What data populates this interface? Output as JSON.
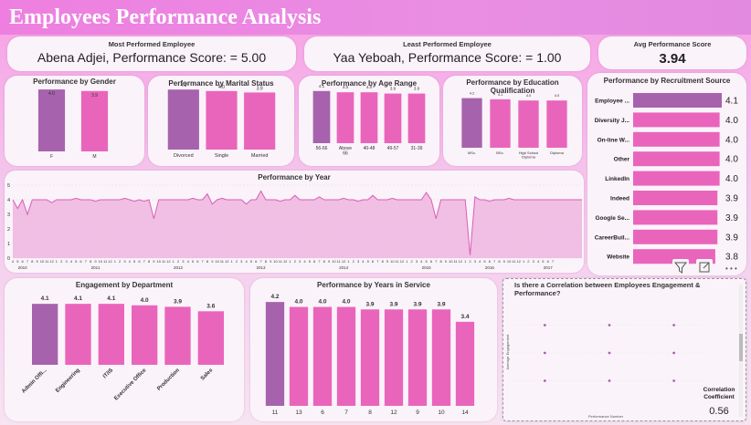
{
  "header": {
    "title": "Employees Performance Analysis"
  },
  "kpis": {
    "most": {
      "label": "Most Performed Employee",
      "value": "Abena Adjei, Performance Score: = 5.00"
    },
    "least": {
      "label": "Least Performed Employee",
      "value": "Yaa Yeboah, Performance Score: = 1.00"
    },
    "avg": {
      "label": "Avg Performance Score",
      "value": "3.94"
    }
  },
  "colors": {
    "purple": "#a762ad",
    "pink": "#e965bb",
    "header": "#ee7fe0",
    "area": "#efb4df",
    "line": "#d95fb6"
  },
  "toolbar": {
    "icons": [
      "filter-icon",
      "focus-mode-icon",
      "more-options-icon"
    ],
    "more": "• • •"
  },
  "chart_data": [
    {
      "id": "gender",
      "type": "bar",
      "title": "Performance by Gender",
      "categories": [
        "F",
        "M"
      ],
      "values": [
        4.0,
        3.9
      ],
      "data_labels": [
        "4.0",
        "3.9"
      ],
      "ylim": [
        0,
        4.3
      ]
    },
    {
      "id": "marital",
      "type": "bar",
      "title": "Performance by Marital Status",
      "categories": [
        "Divorced",
        "Single",
        "Married"
      ],
      "values": [
        4.1,
        4.0,
        3.9
      ],
      "data_labels": [
        "4.1",
        "4.0",
        "3.9"
      ],
      "ylim": [
        0,
        4.3
      ]
    },
    {
      "id": "age",
      "type": "bar",
      "title": "Performance by Age Range",
      "categories": [
        "56-66",
        "Above 66",
        "40-48",
        "49-57",
        "31-39"
      ],
      "values": [
        4.1,
        4.0,
        4.0,
        3.9,
        3.9
      ],
      "data_labels": [
        "4.1",
        "4.0",
        "4.0",
        "3.9",
        "3.9"
      ],
      "ylim": [
        0,
        4.3
      ]
    },
    {
      "id": "education",
      "type": "bar",
      "title": "Performance by Education Qualification",
      "categories": [
        "MSc.",
        "BSc.",
        "High School Diploma",
        "Diploma"
      ],
      "values": [
        4.2,
        4.1,
        4.0,
        4.0
      ],
      "data_labels": [
        "4.2",
        "4.1",
        "4.0",
        "4.0"
      ],
      "ylim": [
        0,
        4.4
      ]
    },
    {
      "id": "recruitment",
      "type": "bar",
      "orientation": "horizontal",
      "title": "Performance by Recruitment Source",
      "categories": [
        "Employee ...",
        "Diversity J...",
        "On-line W...",
        "Other",
        "LinkedIn",
        "Indeed",
        "Google Se...",
        "CareerBuil...",
        "Website"
      ],
      "values": [
        4.1,
        4.0,
        4.0,
        4.0,
        4.0,
        3.9,
        3.9,
        3.9,
        3.8
      ],
      "data_labels": [
        "4.1",
        "4.0",
        "4.0",
        "4.0",
        "4.0",
        "3.9",
        "3.9",
        "3.9",
        "3.8"
      ],
      "xlim": [
        0,
        4.1
      ]
    },
    {
      "id": "year",
      "type": "area",
      "title": "Performance by Year",
      "ylim": [
        0,
        5
      ],
      "yticks": [
        "0",
        "1",
        "2",
        "3",
        "4",
        "5"
      ],
      "years": [
        "2010",
        "2011",
        "2012",
        "2013",
        "2014",
        "2015",
        "2016",
        "2017"
      ],
      "year_month_index": [
        2,
        17,
        34,
        51,
        68,
        85,
        98,
        110
      ],
      "months": [
        4,
        5,
        6,
        7,
        8,
        9,
        10,
        11,
        12,
        1,
        2,
        3,
        4,
        5,
        6,
        7,
        8,
        9,
        10,
        11,
        12,
        1,
        2,
        3,
        4,
        5,
        6,
        7,
        8,
        9,
        10,
        11,
        12,
        1,
        2,
        3,
        4,
        5,
        6,
        7,
        8,
        9,
        10,
        11,
        12,
        1,
        2,
        3,
        4,
        5,
        6,
        7,
        8,
        9,
        10,
        11,
        12,
        1,
        2,
        3,
        4,
        5,
        6,
        7,
        8,
        9,
        10,
        11,
        12,
        1,
        2,
        3,
        4,
        5,
        6,
        7,
        8,
        9,
        10,
        11,
        12,
        1,
        2,
        3,
        4,
        5,
        6,
        7,
        8,
        9,
        10,
        11,
        12,
        1,
        2,
        3,
        4,
        5,
        6,
        7,
        8,
        9,
        10,
        11,
        12,
        1,
        2,
        3,
        4,
        5,
        6,
        7
      ],
      "values": [
        4.0,
        3.4,
        4.0,
        3.0,
        4.0,
        4.0,
        4.0,
        4.0,
        3.8,
        4.0,
        4.0,
        4.0,
        4.0,
        4.1,
        4.0,
        4.0,
        4.0,
        3.9,
        4.0,
        4.0,
        4.0,
        4.0,
        4.0,
        4.1,
        4.0,
        3.9,
        4.0,
        3.9,
        4.0,
        2.7,
        4.0,
        4.0,
        4.0,
        4.0,
        4.0,
        4.0,
        4.0,
        4.1,
        4.0,
        4.0,
        4.4,
        3.7,
        4.0,
        4.1,
        4.0,
        4.0,
        4.0,
        4.0,
        3.7,
        4.0,
        4.0,
        4.6,
        4.0,
        4.0,
        4.0,
        3.9,
        4.0,
        4.0,
        4.3,
        4.0,
        4.0,
        4.0,
        4.0,
        4.2,
        4.0,
        4.0,
        4.0,
        4.0,
        4.1,
        4.0,
        4.0,
        3.9,
        4.0,
        4.0,
        4.3,
        4.0,
        4.0,
        4.0,
        4.1,
        4.0,
        4.0,
        4.0,
        4.0,
        4.0,
        4.0,
        4.5,
        4.0,
        2.7,
        4.0,
        4.0,
        4.0,
        4.0,
        4.0,
        4.0,
        0.2,
        4.2,
        4.0,
        4.0,
        3.9,
        4.0,
        4.0,
        4.0,
        4.1,
        4.0,
        4.0,
        4.0,
        4.0,
        4.0,
        4.0,
        4.0,
        4.0,
        4.0,
        4.0,
        4.0,
        4.0,
        4.0,
        4.0,
        4.0
      ]
    },
    {
      "id": "department",
      "type": "bar",
      "title": "Engagement by Department",
      "categories": [
        "Admin Offi...",
        "Engineering",
        "IT/IS",
        "Executive Office",
        "Production",
        "Sales"
      ],
      "values": [
        4.1,
        4.1,
        4.1,
        4.0,
        3.9,
        3.6
      ],
      "data_labels": [
        "4.1",
        "4.1",
        "4.1",
        "4.0",
        "3.9",
        "3.6"
      ],
      "ylim": [
        0,
        4.6
      ]
    },
    {
      "id": "service",
      "type": "bar",
      "title": "Performance by Years in Service",
      "categories": [
        "11",
        "13",
        "6",
        "7",
        "8",
        "12",
        "9",
        "10",
        "14"
      ],
      "values": [
        4.2,
        4.0,
        4.0,
        4.0,
        3.9,
        3.9,
        3.9,
        3.9,
        3.4
      ],
      "data_labels": [
        "4.2",
        "4.0",
        "4.0",
        "4.0",
        "3.9",
        "3.9",
        "3.9",
        "3.9",
        "3.4"
      ],
      "ylim": [
        0,
        4.5
      ]
    },
    {
      "id": "correlation",
      "type": "scatter",
      "title": "Is there a Correlation between Employees Engagement & Performance?",
      "xlabel": "Performance Number",
      "ylabel": "Average Engagement",
      "x": [
        2,
        2,
        2,
        3,
        3,
        3,
        4,
        4,
        4
      ],
      "y": [
        4.5,
        4.0,
        3.5,
        4.5,
        4.0,
        3.5,
        4.5,
        4.0,
        3.5
      ],
      "coefficient": {
        "label": "Correlation Coefficient",
        "value": "0.56"
      }
    }
  ]
}
